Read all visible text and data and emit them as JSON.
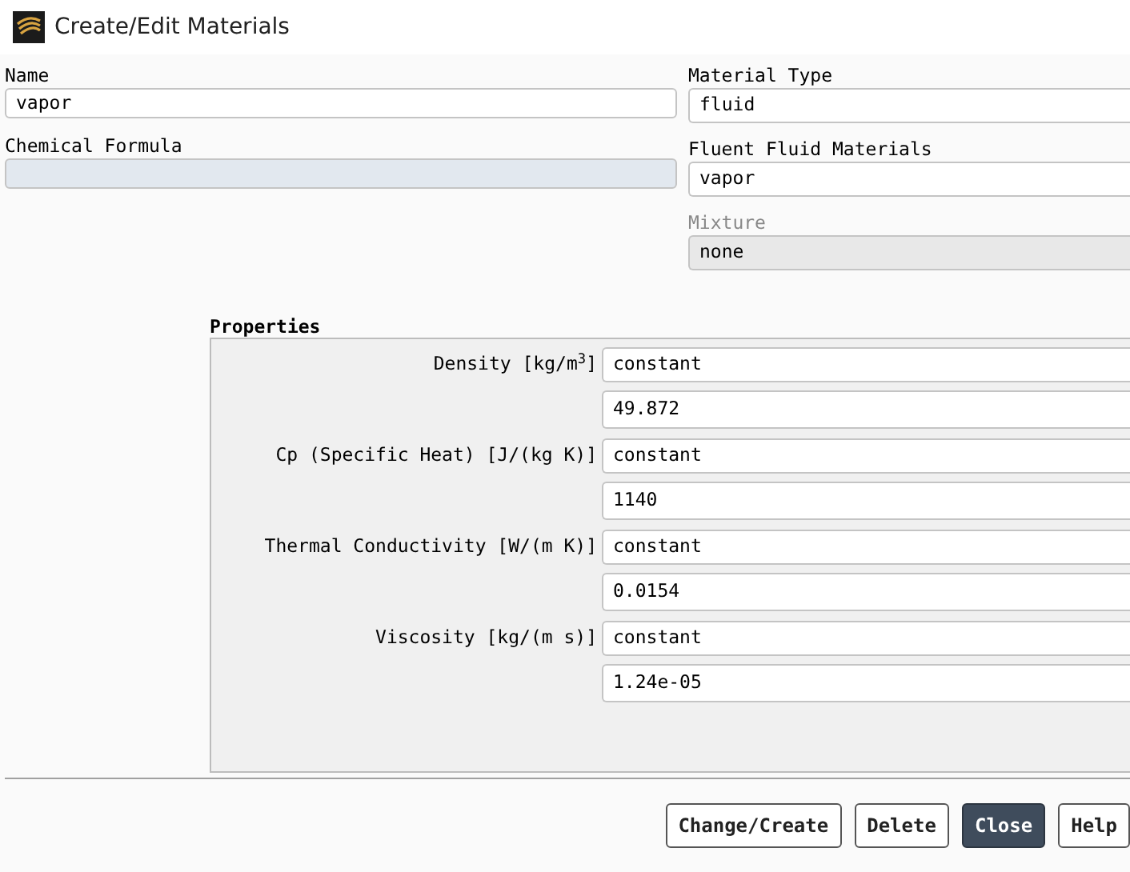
{
  "window": {
    "title": "Create/Edit Materials"
  },
  "left_fields": [
    {
      "label": "Name",
      "value": "vapor",
      "kind": "text"
    },
    {
      "label": "Chemical Formula",
      "kind": "formula"
    }
  ],
  "right_fields": [
    {
      "label": "Material Type",
      "value": "fluid",
      "disabled": false
    },
    {
      "label": "Fluent Fluid Materials",
      "value": "vapor",
      "disabled": false
    },
    {
      "label": "Mixture",
      "value": "none",
      "disabled": true
    }
  ],
  "properties": {
    "title": "Properties",
    "items": [
      {
        "label": "Density [kg/m$^{3}$]",
        "method": "constant",
        "value": "49.872"
      },
      {
        "label": "Cp (Specific Heat) [J/(kg K)]",
        "method": "constant",
        "value": "1140"
      },
      {
        "label": "Thermal Conductivity [W/(m K)]",
        "method": "constant",
        "value": "0.0154"
      },
      {
        "label": "Viscosity [kg/(m s)]",
        "method": "constant",
        "value": "1.24e-05"
      }
    ]
  },
  "buttons": [
    {
      "label": "Change/Create",
      "focused": false
    },
    {
      "label": "Delete",
      "focused": false
    },
    {
      "label": "Close",
      "focused": true
    },
    {
      "label": "Help",
      "focused": false
    }
  ]
}
